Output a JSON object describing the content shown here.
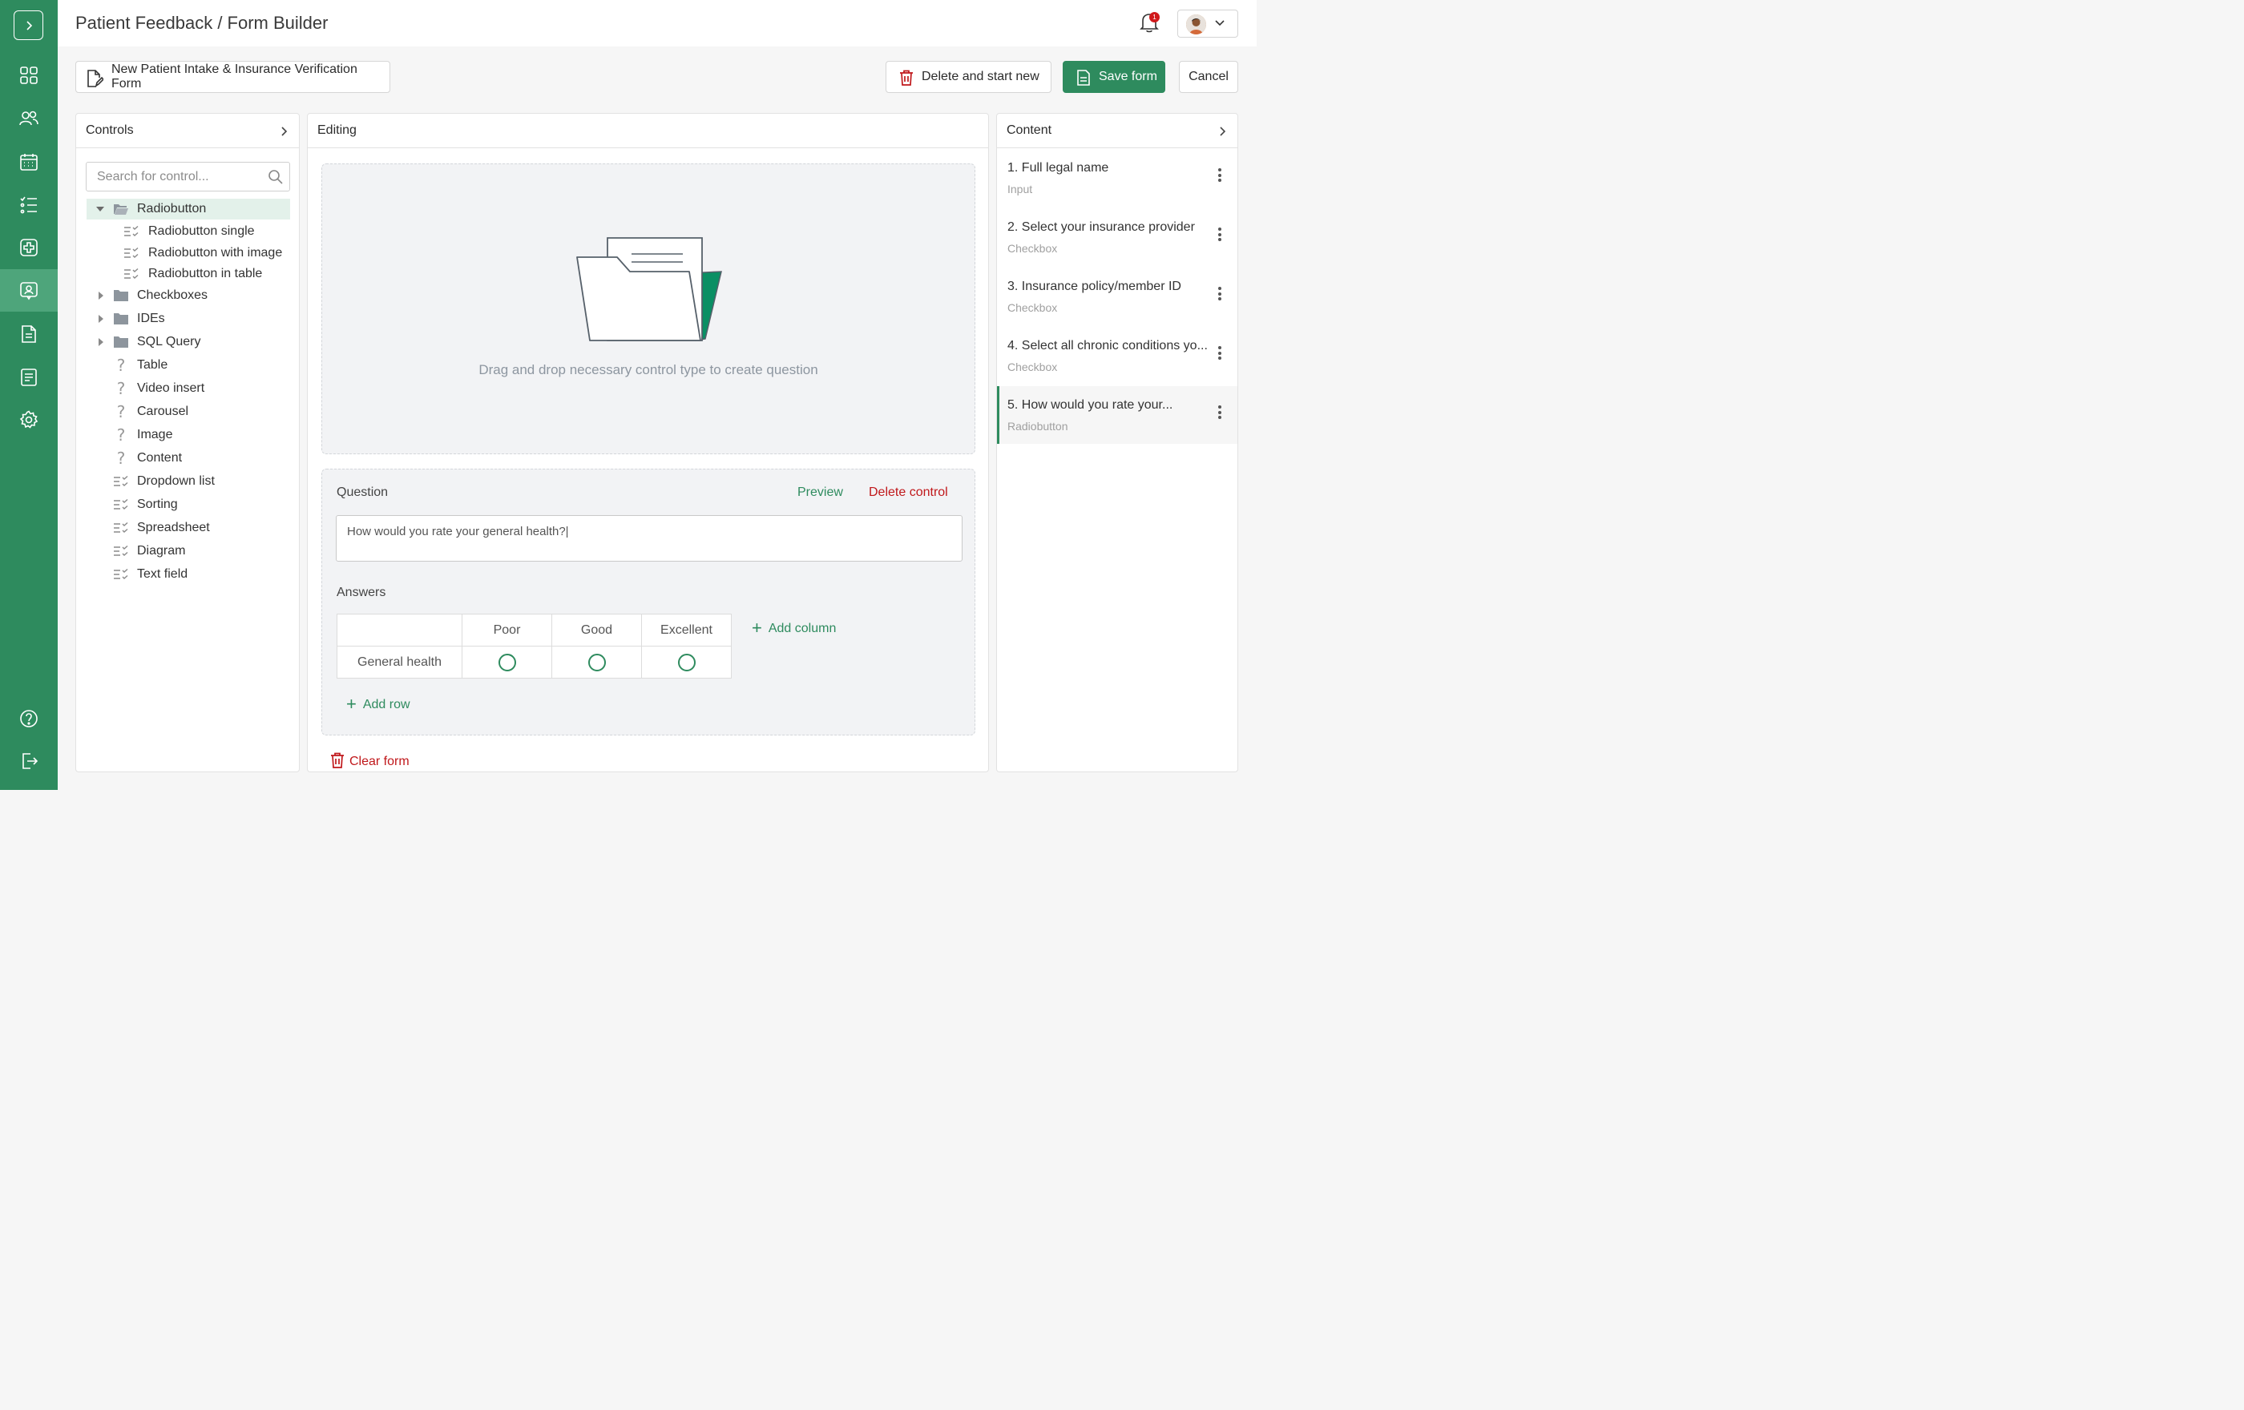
{
  "header": {
    "title": "Patient Feedback / Form Builder",
    "notification_count": "1"
  },
  "toolbar": {
    "form_name": "New Patient Intake & Insurance Verification Form",
    "delete_label": "Delete and start new",
    "save_label": "Save form",
    "cancel_label": "Cancel"
  },
  "sidebar": {
    "nav": [
      "dashboard",
      "patients",
      "calendar",
      "checklist",
      "medical",
      "feedback",
      "documents",
      "reports",
      "settings",
      "help",
      "logout"
    ],
    "active": "feedback"
  },
  "controls": {
    "title": "Controls",
    "search_placeholder": "Search for control...",
    "tree": [
      {
        "label": "Radiobutton",
        "type": "folder",
        "expanded": true
      },
      {
        "label": "Radiobutton single",
        "type": "child"
      },
      {
        "label": "Radiobutton with image",
        "type": "child"
      },
      {
        "label": "Radiobutton in table",
        "type": "child"
      },
      {
        "label": "Checkboxes",
        "type": "folder"
      },
      {
        "label": "IDEs",
        "type": "folder"
      },
      {
        "label": "SQL Query",
        "type": "folder"
      },
      {
        "label": "Table",
        "type": "unknown"
      },
      {
        "label": "Video insert",
        "type": "unknown"
      },
      {
        "label": "Carousel",
        "type": "unknown"
      },
      {
        "label": "Image",
        "type": "unknown"
      },
      {
        "label": "Content",
        "type": "unknown"
      },
      {
        "label": "Dropdown list",
        "type": "control"
      },
      {
        "label": "Sorting",
        "type": "control"
      },
      {
        "label": "Spreadsheet",
        "type": "control"
      },
      {
        "label": "Diagram",
        "type": "control"
      },
      {
        "label": "Text field",
        "type": "control"
      }
    ]
  },
  "editing": {
    "title": "Editing",
    "drop_text": "Drag and drop necessary control type to create question",
    "question_label": "Question",
    "preview_label": "Preview",
    "delete_control_label": "Delete control",
    "question_value": "How would you rate your general health?|",
    "answers_label": "Answers",
    "columns": [
      "Poor",
      "Good",
      "Excellent"
    ],
    "rows": [
      "General health"
    ],
    "add_column_label": "Add column",
    "add_row_label": "Add row",
    "clear_label": "Clear form"
  },
  "content": {
    "title": "Content",
    "items": [
      {
        "title": "1. Full legal name",
        "type": "Input"
      },
      {
        "title": "2. Select your insurance provider",
        "type": "Checkbox"
      },
      {
        "title": "3. Insurance policy/member ID",
        "type": "Checkbox"
      },
      {
        "title": "4. Select all chronic conditions yo...",
        "type": "Checkbox"
      },
      {
        "title": "5. How would you rate your...",
        "type": "Radiobutton"
      }
    ]
  },
  "colors": {
    "brand": "#2e8b5e",
    "danger": "#c0181b",
    "accent_fill": "#0a8f64"
  }
}
